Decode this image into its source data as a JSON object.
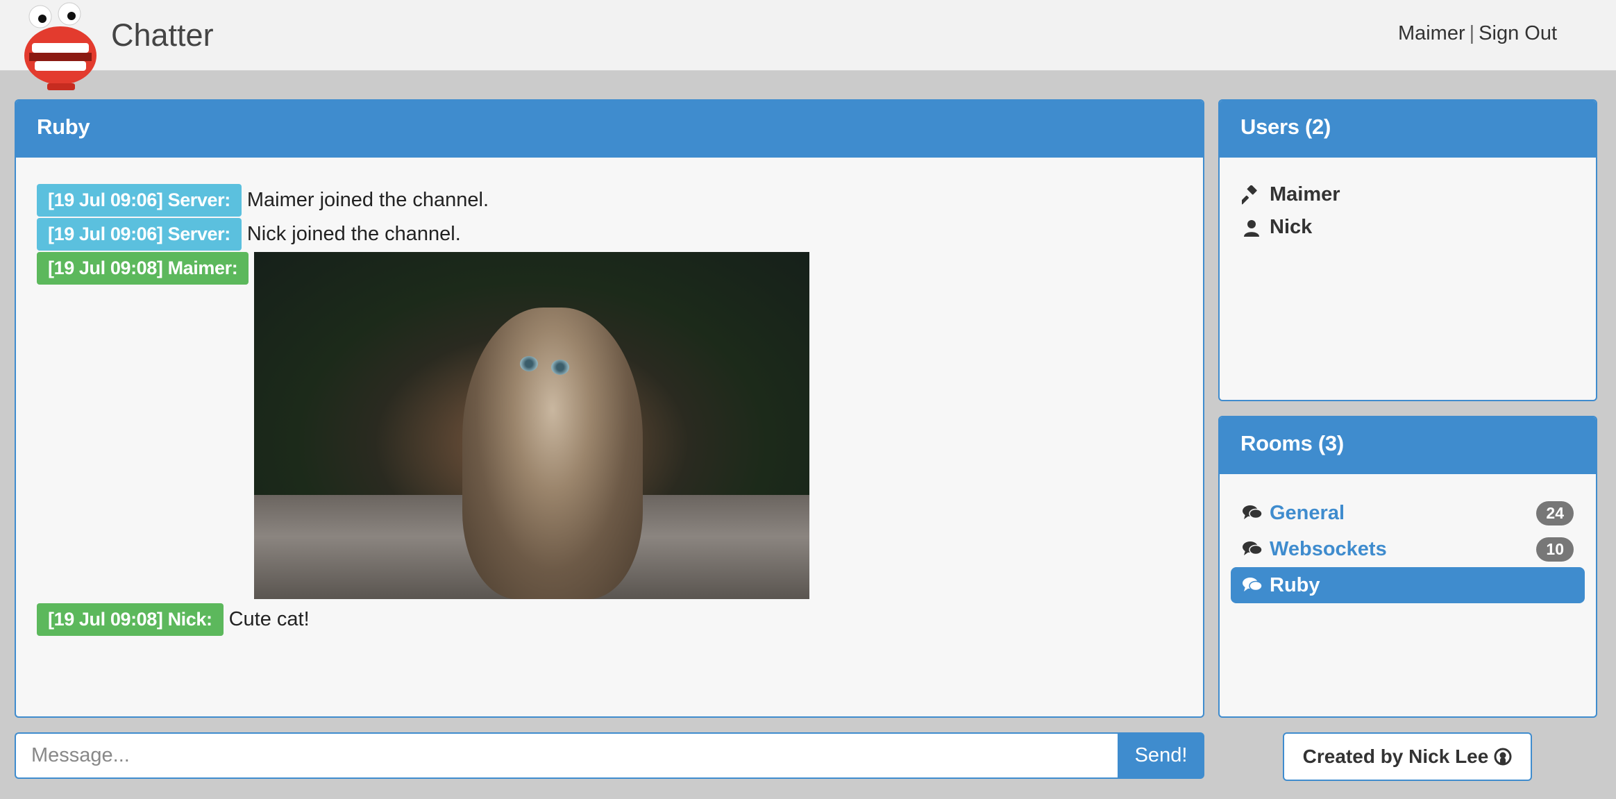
{
  "app": {
    "brand": "Chatter",
    "logo_icon": "chattering-teeth-logo"
  },
  "nav": {
    "username": "Maimer",
    "separator": "|",
    "signout_label": "Sign Out"
  },
  "chat": {
    "room_title": "Ruby",
    "messages": [
      {
        "label": "[19 Jul 09:06] Server:",
        "type": "server",
        "text": "Maimer joined the channel."
      },
      {
        "label": "[19 Jul 09:06] Server:",
        "type": "server",
        "text": "Nick joined the channel."
      },
      {
        "label": "[19 Jul 09:08] Maimer:",
        "type": "user",
        "image": "kitten-photo"
      },
      {
        "label": "[19 Jul 09:08] Nick:",
        "type": "user",
        "text": "Cute cat!"
      }
    ]
  },
  "users": {
    "title": "Users (2)",
    "items": [
      {
        "name": "Maimer",
        "icon": "gavel-icon"
      },
      {
        "name": "Nick",
        "icon": "user-icon"
      }
    ]
  },
  "rooms": {
    "title": "Rooms (3)",
    "items": [
      {
        "name": "General",
        "count": "24",
        "active": false
      },
      {
        "name": "Websockets",
        "count": "10",
        "active": false
      },
      {
        "name": "Ruby",
        "count": "",
        "active": true
      }
    ]
  },
  "composer": {
    "placeholder": "Message...",
    "send_label": "Send!"
  },
  "footer": {
    "credit_label": "Created by Nick Lee"
  },
  "colors": {
    "primary": "#3f8cce",
    "server_label": "#5bc0de",
    "user_label": "#5cb85c",
    "badge": "#777777"
  }
}
